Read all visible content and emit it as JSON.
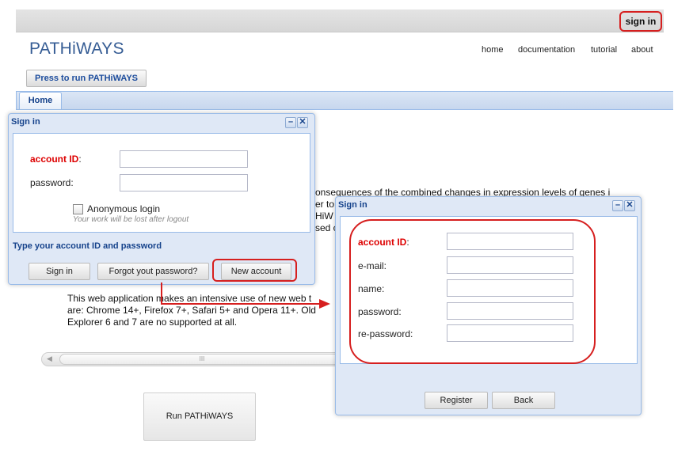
{
  "header": {
    "sign_in": "sign in",
    "logo": "PATHiWAYS",
    "nav": [
      "home",
      "documentation",
      "tutorial",
      "about"
    ]
  },
  "run_top_label": "Press to run PATHiWAYS",
  "tabs": [
    "Home"
  ],
  "main": {
    "bg_line_1": "onsequences of the combined changes in expression levels of genes i",
    "frag_a": "er to",
    "frag_b": "HiW",
    "frag_c": "sed c",
    "browser_note": [
      "This web application makes an intensive use of new web t",
      "are: Chrome 14+, Firefox 7+, Safari 5+ and Opera 11+. Old",
      "Explorer 6 and 7 are no supported at all."
    ],
    "scroll_grip": "III",
    "run_button": "Run PATHiWAYS"
  },
  "signin_window": {
    "title": "Sign in",
    "account_id_label": "account ID",
    "account_id_colon": ":",
    "password_label": "password:",
    "anonymous_label": "Anonymous login",
    "anonymous_note": "Your work will be lost after logout",
    "status": "Type your account ID and password",
    "buttons": {
      "sign_in": "Sign in",
      "forgot": "Forgot yout password?",
      "new_account": "New account"
    }
  },
  "register_window": {
    "title": "Sign in",
    "labels": {
      "account_id": "account ID",
      "email": "e-mail:",
      "name": "name:",
      "password": "password:",
      "repassword": "re-password:"
    },
    "account_id_colon": ":",
    "buttons": {
      "register": "Register",
      "back": "Back"
    }
  },
  "colors": {
    "highlight": "#d61f1f",
    "window_title": "#15428b",
    "logo": "#355c94"
  }
}
